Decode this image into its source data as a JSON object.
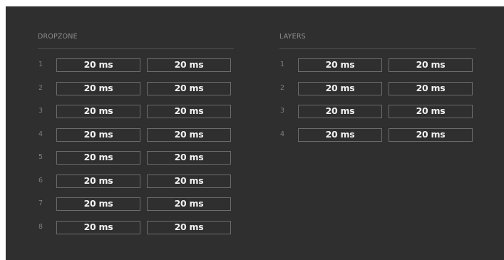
{
  "dropzone": {
    "title": "DROPZONE",
    "rows": [
      {
        "index": "1",
        "value_a": "20 ms",
        "value_b": "20 ms"
      },
      {
        "index": "2",
        "value_a": "20 ms",
        "value_b": "20 ms"
      },
      {
        "index": "3",
        "value_a": "20 ms",
        "value_b": "20 ms"
      },
      {
        "index": "4",
        "value_a": "20 ms",
        "value_b": "20 ms"
      },
      {
        "index": "5",
        "value_a": "20 ms",
        "value_b": "20 ms"
      },
      {
        "index": "6",
        "value_a": "20 ms",
        "value_b": "20 ms"
      },
      {
        "index": "7",
        "value_a": "20 ms",
        "value_b": "20 ms"
      },
      {
        "index": "8",
        "value_a": "20 ms",
        "value_b": "20 ms"
      }
    ]
  },
  "layers": {
    "title": "LAYERS",
    "rows": [
      {
        "index": "1",
        "value_a": "20 ms",
        "value_b": "20 ms"
      },
      {
        "index": "2",
        "value_a": "20 ms",
        "value_b": "20 ms"
      },
      {
        "index": "3",
        "value_a": "20 ms",
        "value_b": "20 ms"
      },
      {
        "index": "4",
        "value_a": "20 ms",
        "value_b": "20 ms"
      }
    ]
  },
  "colors": {
    "panel_background": "#2f2f2f",
    "field_border": "#6c6c6c",
    "value_text": "#f2f2f2",
    "label_text": "#8e8e8e"
  }
}
